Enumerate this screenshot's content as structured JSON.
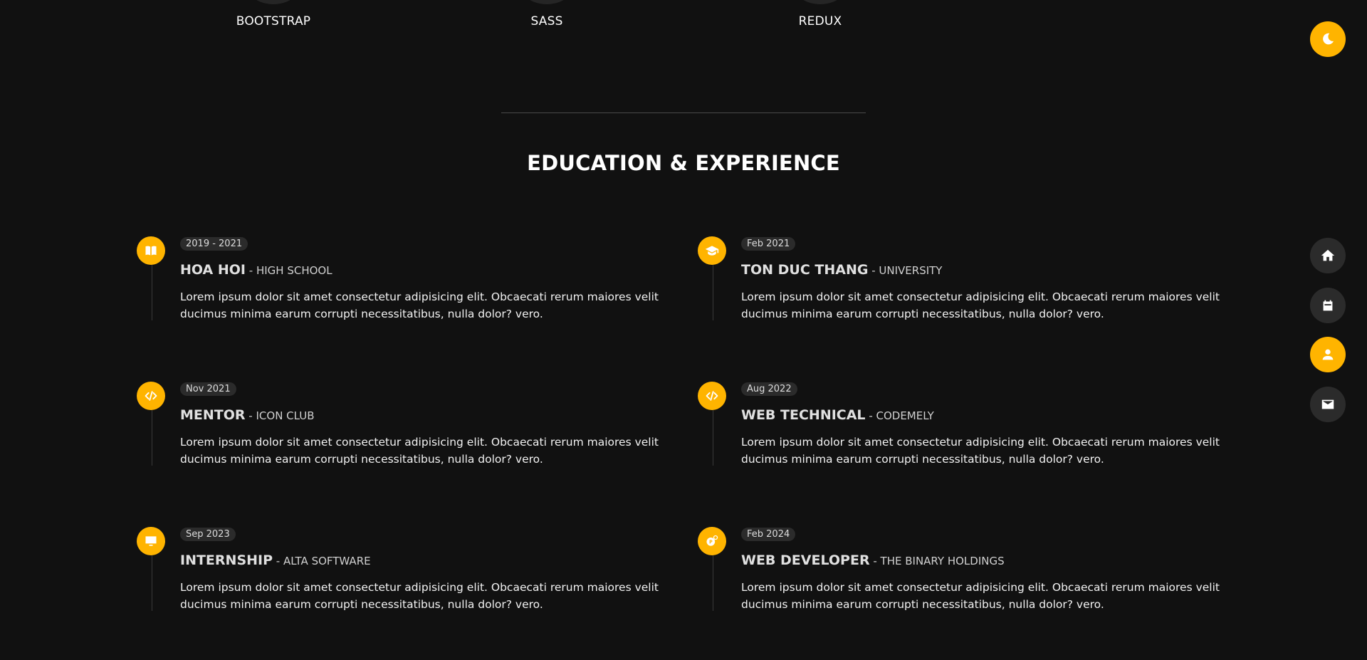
{
  "skills": [
    {
      "name": "BOOTSTRAP"
    },
    {
      "name": "SASS"
    },
    {
      "name": "REDUX"
    }
  ],
  "section_title": "EDUCATION & EXPERIENCE",
  "timeline": [
    {
      "date": "2019 - 2021",
      "role": "HOA HOI",
      "separator": " - ",
      "org": "HIGH SCHOOL",
      "icon": "book-icon",
      "description": "Lorem ipsum dolor sit amet consectetur adipisicing elit. Obcaecati rerum maiores velit ducimus minima earum corrupti necessitatibus, nulla dolor? vero."
    },
    {
      "date": "Feb 2021",
      "role": "TON DUC THANG",
      "separator": " - ",
      "org": "UNIVERSITY",
      "icon": "graduation-cap-icon",
      "description": "Lorem ipsum dolor sit amet consectetur adipisicing elit. Obcaecati rerum maiores velit ducimus minima earum corrupti necessitatibus, nulla dolor? vero."
    },
    {
      "date": "Nov 2021",
      "role": "MENTOR",
      "separator": " - ",
      "org": "ICON CLUB",
      "icon": "code-icon",
      "description": "Lorem ipsum dolor sit amet consectetur adipisicing elit. Obcaecati rerum maiores velit ducimus minima earum corrupti necessitatibus, nulla dolor? vero."
    },
    {
      "date": "Aug 2022",
      "role": "WEB TECHNICAL",
      "separator": " - ",
      "org": "CODEMELY",
      "icon": "code-icon",
      "description": "Lorem ipsum dolor sit amet consectetur adipisicing elit. Obcaecati rerum maiores velit ducimus minima earum corrupti necessitatibus, nulla dolor? vero."
    },
    {
      "date": "Sep 2023",
      "role": "INTERNSHIP",
      "separator": " - ",
      "org": "ALTA SOFTWARE",
      "icon": "monitor-icon",
      "description": "Lorem ipsum dolor sit amet consectetur adipisicing elit. Obcaecati rerum maiores velit ducimus minima earum corrupti necessitatibus, nulla dolor? vero."
    },
    {
      "date": "Feb 2024",
      "role": "WEB DEVELOPER",
      "separator": " - ",
      "org": "THE BINARY HOLDINGS",
      "icon": "dev-settings-icon",
      "description": "Lorem ipsum dolor sit amet consectetur adipisicing elit. Obcaecati rerum maiores velit ducimus minima earum corrupti necessitatibus, nulla dolor? vero."
    }
  ],
  "side_nav": [
    {
      "icon": "moon-icon",
      "label": "theme-toggle",
      "active": true
    },
    {
      "icon": "home-icon",
      "label": "home",
      "active": false
    },
    {
      "icon": "portfolio-icon",
      "label": "portfolio",
      "active": false
    },
    {
      "icon": "user-icon",
      "label": "about",
      "active": true
    },
    {
      "icon": "mail-icon",
      "label": "contact",
      "active": false
    }
  ],
  "colors": {
    "background": "#111111",
    "accent": "#ffb400",
    "badge": "#2b2b2b",
    "button": "#2b2b2b"
  }
}
